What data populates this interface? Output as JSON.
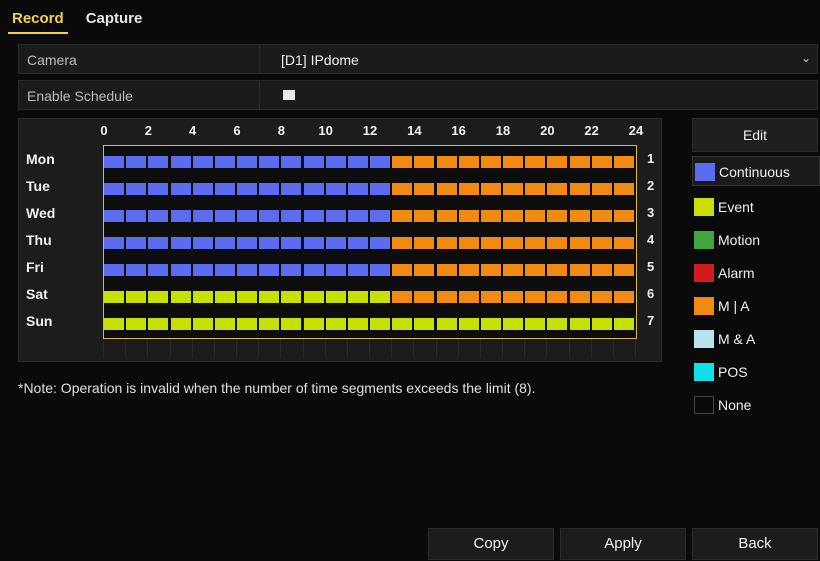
{
  "tabs": [
    {
      "label": "Record",
      "active": true
    },
    {
      "label": "Capture",
      "active": false
    }
  ],
  "camera": {
    "label": "Camera",
    "value": "[D1] IPdome"
  },
  "enable_schedule": {
    "label": "Enable Schedule",
    "checked": true
  },
  "schedule": {
    "hours": [
      "0",
      "2",
      "4",
      "6",
      "8",
      "10",
      "12",
      "14",
      "16",
      "18",
      "20",
      "22",
      "24"
    ],
    "days": [
      {
        "label": "Mon",
        "num": "1",
        "segments": [
          {
            "start": 0,
            "end": 13,
            "type": "Continuous"
          },
          {
            "start": 13,
            "end": 24,
            "type": "M | A"
          }
        ]
      },
      {
        "label": "Tue",
        "num": "2",
        "segments": [
          {
            "start": 0,
            "end": 13,
            "type": "Continuous"
          },
          {
            "start": 13,
            "end": 24,
            "type": "M | A"
          }
        ]
      },
      {
        "label": "Wed",
        "num": "3",
        "segments": [
          {
            "start": 0,
            "end": 13,
            "type": "Continuous"
          },
          {
            "start": 13,
            "end": 24,
            "type": "M | A"
          }
        ]
      },
      {
        "label": "Thu",
        "num": "4",
        "segments": [
          {
            "start": 0,
            "end": 13,
            "type": "Continuous"
          },
          {
            "start": 13,
            "end": 24,
            "type": "M | A"
          }
        ]
      },
      {
        "label": "Fri",
        "num": "5",
        "segments": [
          {
            "start": 0,
            "end": 13,
            "type": "Continuous"
          },
          {
            "start": 13,
            "end": 24,
            "type": "M | A"
          }
        ]
      },
      {
        "label": "Sat",
        "num": "6",
        "segments": [
          {
            "start": 0,
            "end": 13,
            "type": "Event"
          },
          {
            "start": 13,
            "end": 24,
            "type": "M | A"
          }
        ]
      },
      {
        "label": "Sun",
        "num": "7",
        "segments": [
          {
            "start": 0,
            "end": 24,
            "type": "Event"
          }
        ]
      }
    ]
  },
  "edit_label": "Edit",
  "legend": [
    {
      "label": "Continuous",
      "color": "#5b6cf0"
    },
    {
      "label": "Event",
      "color": "#c8e000"
    },
    {
      "label": "Motion",
      "color": "#3ea63a"
    },
    {
      "label": "Alarm",
      "color": "#d01c1c"
    },
    {
      "label": "M | A",
      "color": "#f08a10"
    },
    {
      "label": "M & A",
      "color": "#b7e3ea"
    },
    {
      "label": "POS",
      "color": "#10e0e8"
    },
    {
      "label": "None",
      "color": "#0a0a0a"
    }
  ],
  "note": "*Note: Operation is invalid when the number of time segments exceeds the limit (8).",
  "buttons": {
    "copy": "Copy",
    "apply": "Apply",
    "back": "Back"
  }
}
